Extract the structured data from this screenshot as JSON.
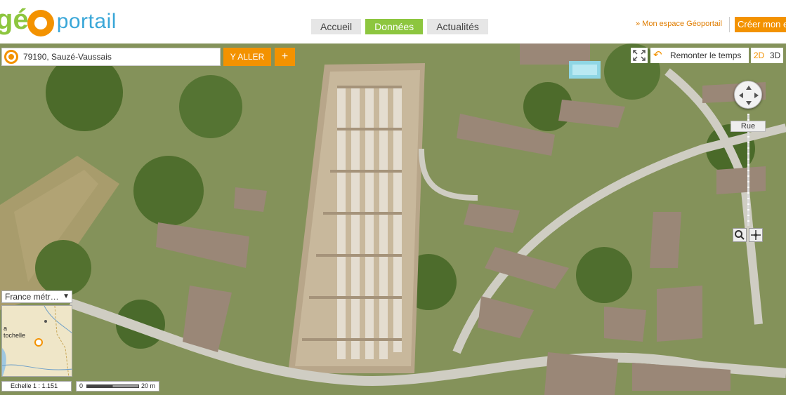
{
  "logo": {
    "g": "g",
    "e": "é",
    "o": "O",
    "portail": "portail"
  },
  "nav": {
    "tabs": [
      {
        "label": "Accueil",
        "active": false
      },
      {
        "label": "Données",
        "active": true
      },
      {
        "label": "Actualités",
        "active": false
      }
    ]
  },
  "account": {
    "espace_label": "» Mon espace Géoportail",
    "creer_label": "Créer mon e"
  },
  "search": {
    "value": "79190, Sauzé-Vaussais",
    "go_label": "Y ALLER",
    "plus_label": "+"
  },
  "controls": {
    "remonter_label": "Remonter le temps",
    "view_2d": "2D",
    "view_3d": "3D",
    "zoom_level_label": "Rue"
  },
  "minimap": {
    "select_value": "France métr…",
    "select_arrow": "▼",
    "place_label_line1": "a",
    "place_label_line2": "tochelle"
  },
  "scale": {
    "ratio_label": "Echelle 1 :",
    "ratio_value": "1.151",
    "bar_min": "0",
    "bar_max": "20 m"
  },
  "colors": {
    "brand_orange": "#f39200",
    "brand_green": "#8dc63f",
    "brand_blue": "#3aa7d8"
  }
}
